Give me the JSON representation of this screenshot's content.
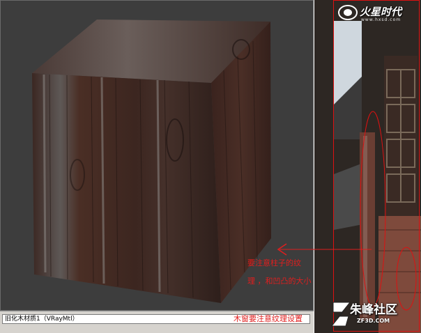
{
  "status": {
    "material_name": "旧化木材质1（VRayMtl）"
  },
  "annotations": {
    "line1": "要注意柱子的纹",
    "line2": "理 ，和凹凸的大小",
    "line3": "木窗要注意纹理设置"
  },
  "watermarks": {
    "top_brand": "火星时代",
    "top_url": "www.hxsd.com",
    "bottom_brand": "朱峰社区",
    "bottom_url": "ZF3D.COM"
  },
  "colors": {
    "viewport_bg": "#3d3d3d",
    "annotation": "#e01e1e",
    "wood_dark": "#3a2620",
    "wood_mid": "#5a3a2e",
    "wood_light": "#8f8a86"
  }
}
